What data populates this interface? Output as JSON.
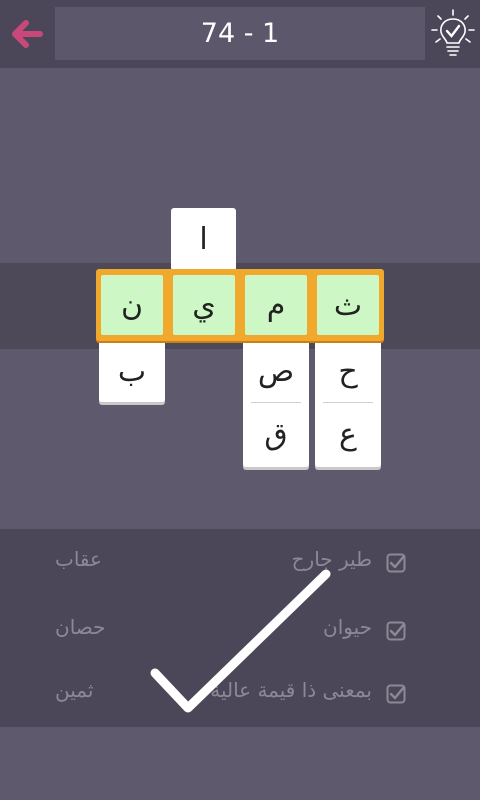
{
  "header": {
    "level": "74 - 1",
    "back_icon": "back-arrow-icon",
    "hint_icon": "lightbulb-check-icon",
    "back_color": "#c9487a"
  },
  "puzzle": {
    "top_letter": "ا",
    "answer_letters": [
      "ن",
      "ي",
      "م",
      "ث"
    ],
    "col1_below": [
      "ب"
    ],
    "col3_below": [
      "ص",
      "ق"
    ],
    "col4_below": [
      "ح",
      "ع"
    ],
    "highlight_color": "#f1a92d",
    "correct_color": "#cdf7c4"
  },
  "clues": [
    {
      "clue": "طير جارح",
      "answer": "عقاب",
      "checked": true
    },
    {
      "clue": "حيوان",
      "answer": "حصان",
      "checked": true
    },
    {
      "clue": "بمعنى ذا قيمة عالية",
      "answer": "ثمين",
      "checked": true
    }
  ],
  "overlay": {
    "icon": "big-checkmark-icon"
  }
}
